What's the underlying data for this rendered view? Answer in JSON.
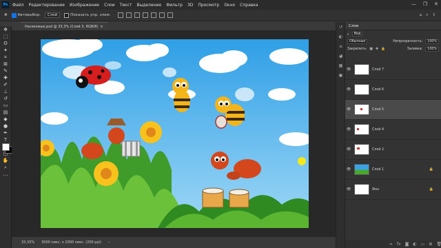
{
  "app": {
    "logo": "Ps",
    "menu": [
      "Файл",
      "Редактирование",
      "Изображение",
      "Слои",
      "Текст",
      "Выделение",
      "Фильтр",
      "3D",
      "Просмотр",
      "Окно",
      "Справка"
    ],
    "window_controls": [
      "—",
      "❐",
      "✕"
    ]
  },
  "options": {
    "autoselect_label": "Автовыбор:",
    "autoselect_value": "Слой",
    "transform_label": "Показать упр. элем."
  },
  "document": {
    "tab_title": "Насекомые.psd @ 33,3% (Слой 3, RGB/8)",
    "zoom": "33,33%",
    "doc_info": "3000 пикс. x 2000 пикс. (200 ppi)"
  },
  "layers_panel": {
    "title": "Слои",
    "filter_label": "Вид",
    "blend_mode": "Обычные",
    "opacity_label": "Непрозрачность:",
    "opacity_value": "100%",
    "lock_label": "Закрепить:",
    "fill_label": "Заливка:",
    "fill_value": "100%",
    "layers": [
      {
        "name": "Слой 7",
        "active": false
      },
      {
        "name": "Слой 6",
        "active": false
      },
      {
        "name": "Слой 5",
        "active": true
      },
      {
        "name": "Слой 4",
        "active": false
      },
      {
        "name": "Слой 2",
        "active": false
      },
      {
        "name": "Слой 1",
        "active": false
      },
      {
        "name": "Фон",
        "active": false
      }
    ]
  },
  "colors": {
    "accent": "#1473e6",
    "sky": "#4fb1ec",
    "grass": "#3f9b2a"
  }
}
